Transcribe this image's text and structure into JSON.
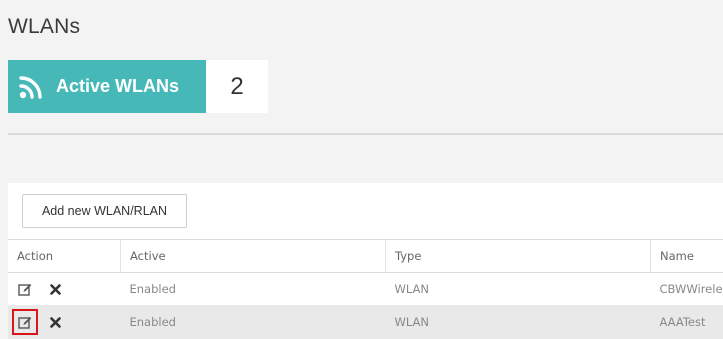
{
  "page": {
    "title": "WLANs"
  },
  "summary": {
    "label": "Active WLANs",
    "count": "2"
  },
  "toolbar": {
    "add_label": "Add new WLAN/RLAN"
  },
  "table": {
    "headers": {
      "action": "Action",
      "active": "Active",
      "type": "Type",
      "name": "Name"
    },
    "rows": [
      {
        "active": "Enabled",
        "type": "WLAN",
        "name": "CBWWireless"
      },
      {
        "active": "Enabled",
        "type": "WLAN",
        "name": "AAATest"
      }
    ]
  },
  "colors": {
    "accent": "#46b8b8",
    "highlight": "#d9141b"
  },
  "icons": {
    "summary": "wifi-icon",
    "edit": "edit-icon",
    "delete": "delete-icon"
  }
}
